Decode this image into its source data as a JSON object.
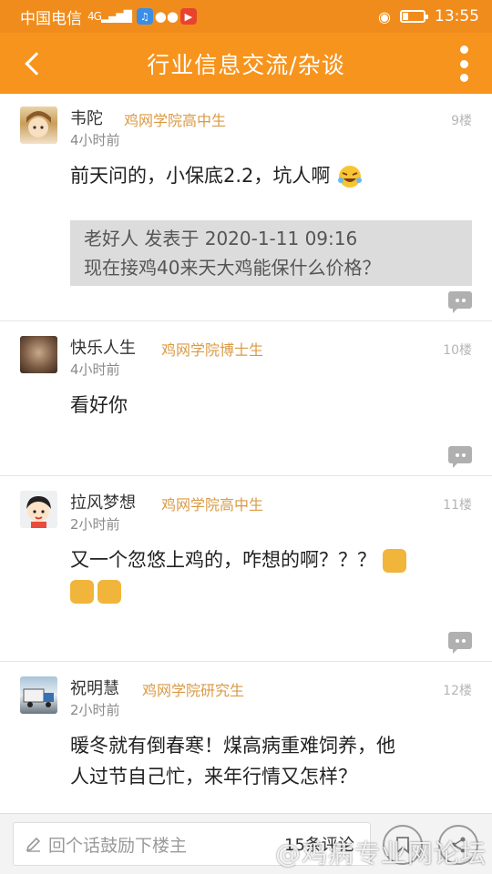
{
  "status_bar": {
    "carrier": "中国电信",
    "network": "4G",
    "time": "13:55"
  },
  "header": {
    "title": "行业信息交流/杂谈"
  },
  "posts": [
    {
      "username": "韦陀",
      "badge": "鸡网学院高中生",
      "floor": "9楼",
      "time": "4小时前",
      "content": "前天问的，小保底2.2，坑人啊",
      "quote": {
        "author_line": "老好人 发表于 2020-1-11 09:16",
        "text": "现在接鸡40来天大鸡能保什么价格？"
      }
    },
    {
      "username": "快乐人生",
      "badge": "鸡网学院博士生",
      "floor": "10楼",
      "time": "4小时前",
      "content": "看好你"
    },
    {
      "username": "拉风梦想",
      "badge": "鸡网学院高中生",
      "floor": "11楼",
      "time": "2小时前",
      "content": "又一个忽悠上鸡的，咋想的啊？？？"
    },
    {
      "username": "祝明慧",
      "badge": "鸡网学院研究生",
      "floor": "12楼",
      "time": "2小时前",
      "content_line1": "暖冬就有倒春寒！煤高病重难饲养，他",
      "content_line2": "人过节自己忙，来年行情又怎样？"
    }
  ],
  "bottom_bar": {
    "input_placeholder": "回个话鼓励下楼主",
    "comment_count": "15条评论"
  },
  "watermark": "@鸡病专业网论坛",
  "colors": {
    "accent": "#f7941d",
    "badge": "#d99a45"
  }
}
